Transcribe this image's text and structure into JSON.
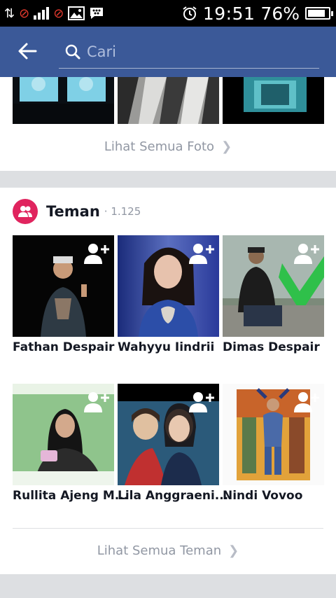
{
  "status_bar": {
    "time": "19:51",
    "battery_percent": "76%",
    "battery_level": 0.76,
    "icons": [
      "signal-icon",
      "data-icon",
      "image-icon",
      "bbm-icon",
      "alarm-icon",
      "battery-icon"
    ]
  },
  "header": {
    "back_icon": "back-arrow-icon",
    "search_icon": "search-icon",
    "search_placeholder": "Cari"
  },
  "photos": {
    "see_all_label": "Lihat Semua Foto"
  },
  "friends": {
    "title": "Teman",
    "count": "1.125",
    "see_all_label": "Lihat Semua Teman",
    "items": [
      {
        "name": "Fathan Despair"
      },
      {
        "name": "Wahyyu Iindrii"
      },
      {
        "name": "Dimas Despair"
      },
      {
        "name": "Rullita Ajeng M..."
      },
      {
        "name": "Lila Anggraeni..."
      },
      {
        "name": "Nindi Vovoo"
      }
    ]
  },
  "colors": {
    "brand_blue": "#3b5998",
    "friends_icon": "#e0245e",
    "muted_text": "#9197a3"
  }
}
